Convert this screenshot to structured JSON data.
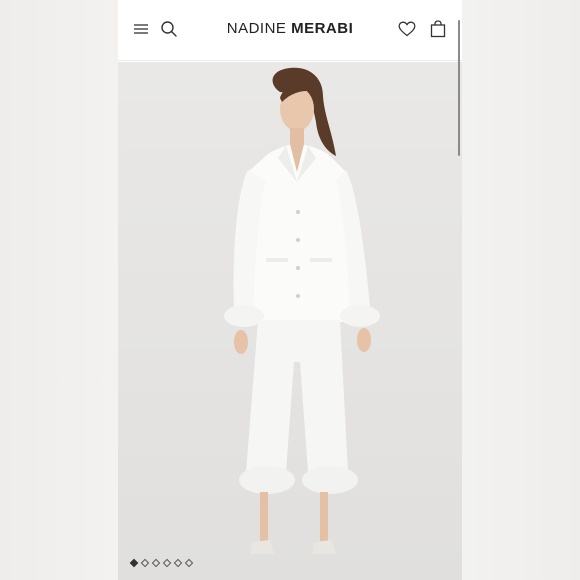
{
  "header": {
    "brand_first": "NADINE",
    "brand_second": "MERABI"
  },
  "icons": {
    "menu": "hamburger-menu-icon",
    "search": "search-icon",
    "wishlist": "heart-icon",
    "cart": "shopping-bag-icon"
  },
  "carousel": {
    "total_slides": 6,
    "active_index": 0
  },
  "colors": {
    "page_bg": "#f1f0ee",
    "header_bg": "#ffffff",
    "text": "#222222",
    "outfit": "#fbfbfa"
  }
}
